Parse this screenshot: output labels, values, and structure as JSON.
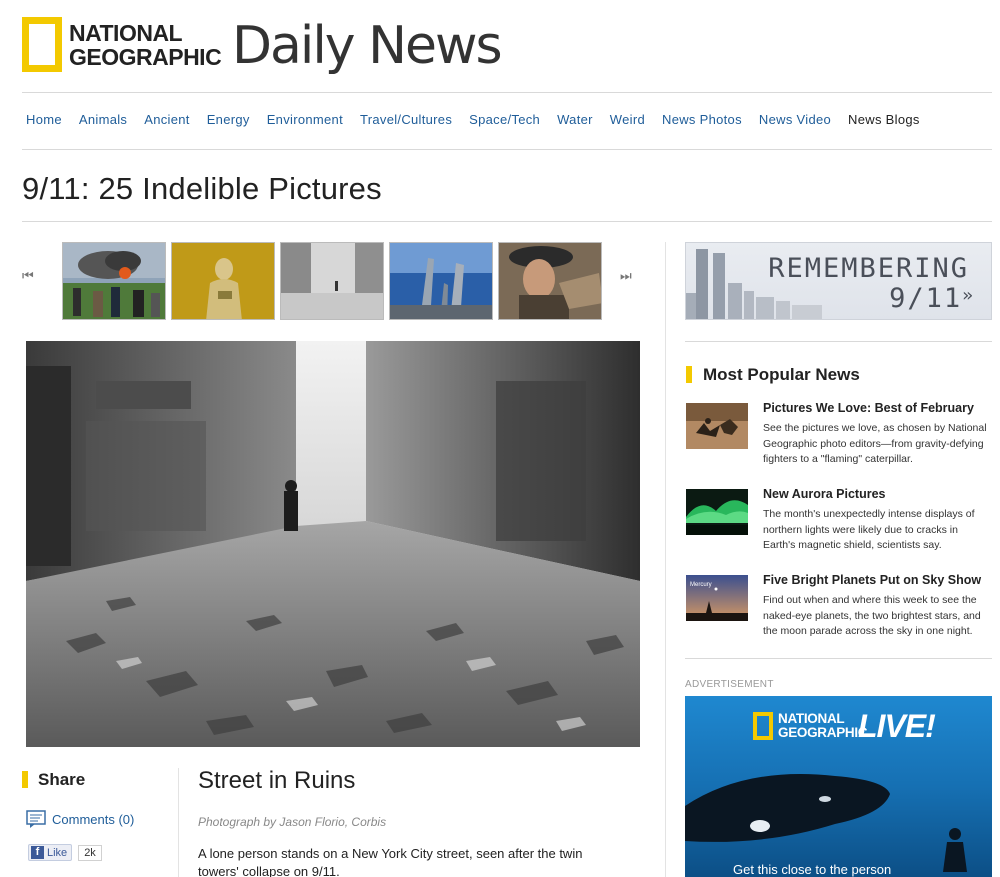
{
  "header": {
    "logo_line1": "NATIONAL",
    "logo_line2": "GEOGRAPHIC",
    "site_title": "Daily News"
  },
  "nav": {
    "items": [
      "Home",
      "Animals",
      "Ancient",
      "Energy",
      "Environment",
      "Travel/Cultures",
      "Space/Tech",
      "Water",
      "Weird",
      "News Photos",
      "News Video",
      "News Blogs"
    ]
  },
  "page": {
    "title": "9/11: 25 Indelible Pictures"
  },
  "carousel": {
    "prev_icon": "⏮",
    "next_icon": "⏭"
  },
  "share": {
    "title": "Share",
    "comments": "Comments (0)",
    "like_label": "Like",
    "like_count": "2k"
  },
  "photo": {
    "title": "Street in Ruins",
    "credit": "Photograph by Jason Florio, Corbis",
    "caption": "A lone person stands on a New York City street, seen after the twin towers' collapse on 9/11."
  },
  "sidebar": {
    "banner_line1": "REMEMBERING",
    "banner_line2": "9/11",
    "banner_arrow": "»",
    "most_popular_title": "Most Popular News",
    "news": [
      {
        "title": "Pictures We Love: Best of February",
        "desc": "See the pictures we love, as chosen by National Geographic photo editors—from gravity-defying fighters to a \"flaming\" caterpillar."
      },
      {
        "title": "New Aurora Pictures",
        "desc": "The month's unexpectedly intense displays of northern lights were likely due to cracks in Earth's magnetic shield, scientists say."
      },
      {
        "title": "Five Bright Planets Put on Sky Show",
        "desc": "Find out when and where this week to see the naked-eye planets, the two brightest stars, and the moon parade across the sky in one night.",
        "thumb_label": "Mercury"
      }
    ],
    "ad_label": "ADVERTISEMENT",
    "ad_ng_line1": "NATIONAL",
    "ad_ng_line2": "GEOGRAPHIC",
    "ad_live": "LIVE!",
    "ad_tagline": "Get this close to the person"
  },
  "colors": {
    "brand_yellow": "#f3c900",
    "link_blue": "#1f5d99"
  }
}
